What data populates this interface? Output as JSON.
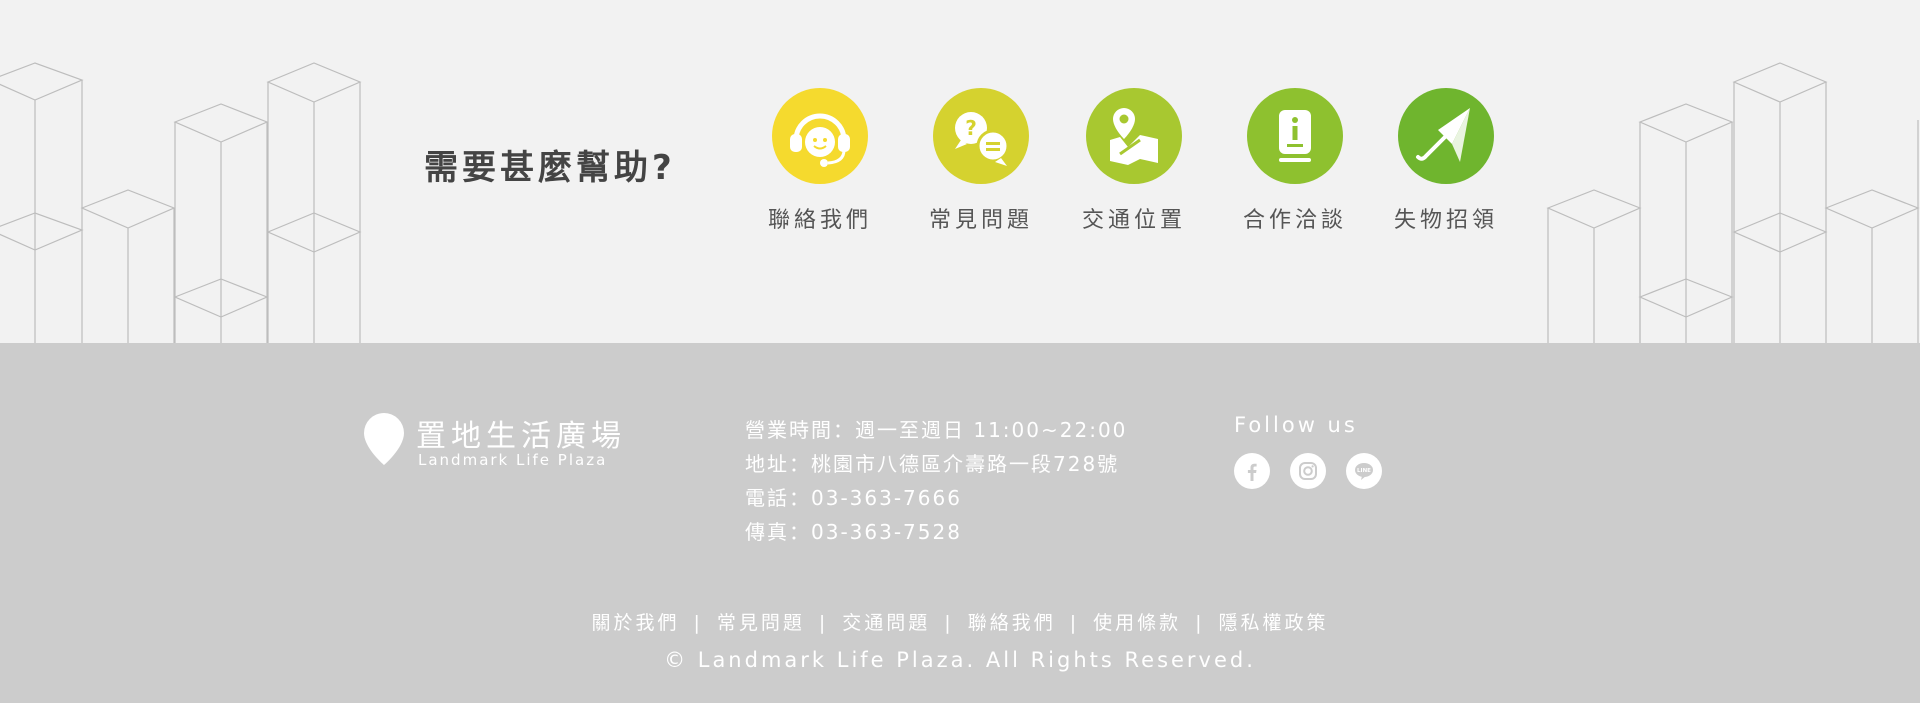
{
  "help": {
    "title": "需要甚麼幫助?",
    "items": [
      {
        "label": "聯絡我們",
        "icon": "customer-service-icon",
        "color": "#f5da2e"
      },
      {
        "label": "常見問題",
        "icon": "faq-chat-icon",
        "color": "#d5d22f"
      },
      {
        "label": "交通位置",
        "icon": "map-pin-icon",
        "color": "#a8c830"
      },
      {
        "label": "合作洽談",
        "icon": "info-document-icon",
        "color": "#8ec12f"
      },
      {
        "label": "失物招領",
        "icon": "umbrella-icon",
        "color": "#6fb52e"
      }
    ]
  },
  "footer": {
    "logo": {
      "cn": "置地生活廣場",
      "en": "Landmark Life Plaza"
    },
    "info": {
      "hours": "營業時間：週一至週日 11:00~22:00",
      "address": "地址：桃園市八德區介壽路一段728號",
      "phone": "電話：03-363-7666",
      "fax": "傳真：03-363-7528"
    },
    "follow": {
      "title": "Follow us",
      "icons": [
        "facebook-icon",
        "instagram-icon",
        "line-icon"
      ]
    },
    "nav": [
      "關於我們",
      "常見問題",
      "交通問題",
      "聯絡我們",
      "使用條款",
      "隱私權政策"
    ],
    "nav_separator": "|",
    "copyright": "© Landmark Life Plaza. All Rights Reserved."
  },
  "colors": {
    "help_bg": "#f2f2f2",
    "footer_bg": "#cccccc",
    "title_text": "#444444",
    "label_text": "#555555",
    "footer_text": "#ffffff"
  }
}
